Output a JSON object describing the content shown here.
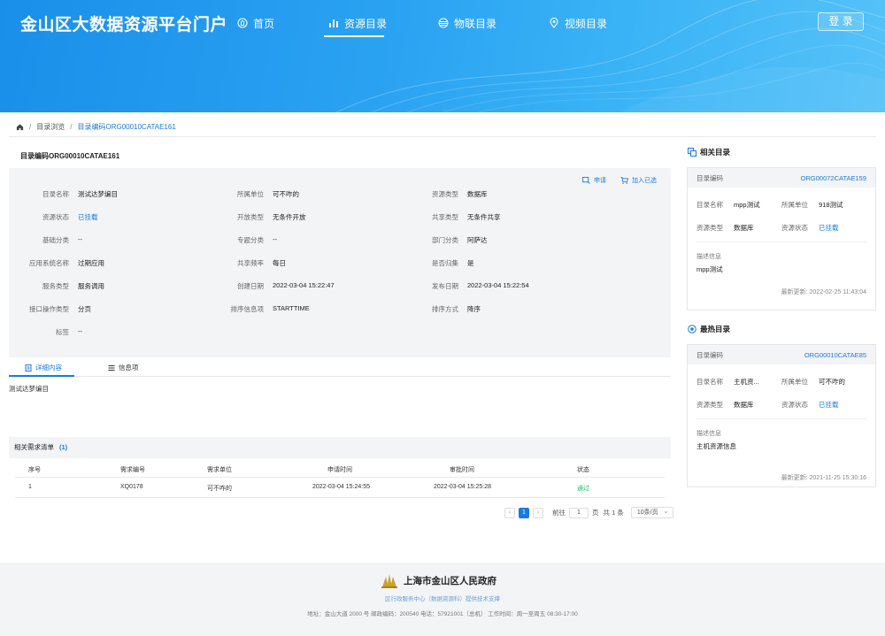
{
  "header": {
    "site_title": "金山区大数据资源平台门户",
    "nav": [
      {
        "label": "首页",
        "icon": "home-icon"
      },
      {
        "label": "资源目录",
        "icon": "bar-chart-icon"
      },
      {
        "label": "物联目录",
        "icon": "layers-icon"
      },
      {
        "label": "视频目录",
        "icon": "location-icon"
      }
    ],
    "active_nav": "资源目录",
    "login": "登 录"
  },
  "breadcrumb": {
    "items": [
      "目录浏览",
      "目录编码ORG00010CATAE161"
    ]
  },
  "detail": {
    "code_title": "目录编码ORG00010CATAE161",
    "actions": {
      "apply": "申请",
      "add": "加入已选"
    },
    "fields": {
      "name_label": "目录名称",
      "name": "测试达梦编目",
      "unit_label": "所属单位",
      "unit": "可不咋的",
      "rtype_label": "资源类型",
      "rtype": "数据库",
      "status_label": "资源状态",
      "status": "已挂载",
      "open_label": "开放类型",
      "open": "无条件开放",
      "share_label": "共享类型",
      "share": "无条件共享",
      "base_label": "基础分类",
      "base": "--",
      "topic_label": "专题分类",
      "topic": "--",
      "dept_label": "部门分类",
      "dept": "阿萨达",
      "app_label": "应用系统名称",
      "app": "过期应用",
      "freq_label": "共享频率",
      "freq": "每日",
      "collect_label": "是否归集",
      "collect": "是",
      "svc_label": "服务类型",
      "svc": "服务调用",
      "created_label": "创建日期",
      "created": "2022-03-04 15:22:47",
      "published_label": "发布日期",
      "published": "2022-03-04 15:22:54",
      "op_label": "接口操作类型",
      "op": "分页",
      "sort_label": "排序信息项",
      "sort": "STARTTIME",
      "order_label": "排序方式",
      "order": "降序",
      "tag_label": "标签",
      "tag": "--"
    }
  },
  "tabs": {
    "detail": "详细内容",
    "info": "信息项"
  },
  "detail_text": "测试达梦编目",
  "demand": {
    "title": "相关需求清单",
    "count": "(1)",
    "columns": [
      "序号",
      "需求编号",
      "需求单位",
      "申请时间",
      "审批时间",
      "状态"
    ],
    "rows": [
      [
        "1",
        "XQ0178",
        "可不咋的",
        "2022-03-04 15:24:55",
        "2022-03-04 15:25:28",
        "通过"
      ]
    ]
  },
  "pager": {
    "prev": "‹",
    "current": "1",
    "next": "›",
    "goto_label": "前往",
    "goto_value": "1",
    "page_unit": "页",
    "total": "共 1 条",
    "size": "10条/页"
  },
  "related": {
    "title": "相关目录",
    "code_label": "目录编码",
    "code": "ORG00072CATAE159",
    "name_label": "目录名称",
    "name": "mpp测试",
    "unit_label": "所属单位",
    "unit": "918测试",
    "type_label": "资源类型",
    "type": "数据库",
    "status_label": "资源状态",
    "status": "已挂载",
    "desc_label": "描述信息",
    "desc": "mpp测试",
    "updated": "最新更新: 2022-02-25 11:43:04"
  },
  "hot": {
    "title": "最热目录",
    "code_label": "目录编码",
    "code": "ORG00010CATAE85",
    "name_label": "目录名称",
    "name": "主机资...",
    "unit_label": "所属单位",
    "unit": "可不咋的",
    "type_label": "资源类型",
    "type": "数据库",
    "status_label": "资源状态",
    "status": "已挂载",
    "desc_label": "描述信息",
    "desc": "主机资源信息",
    "updated": "最新更新: 2021-11-25 15:30:16"
  },
  "footer": {
    "gov": "上海市金山区人民政府",
    "support": "区行政服务中心（数据资源科）提供技术支撑",
    "address": "地址：金山大道 2000 号     邮政编码：200540     电话：57921001（总机）     工作时间：周一至周五 08:30-17:00"
  },
  "colors": {
    "primary": "#1a7ae0",
    "header_blue": "#2ba3f2",
    "success": "#19be6b"
  }
}
